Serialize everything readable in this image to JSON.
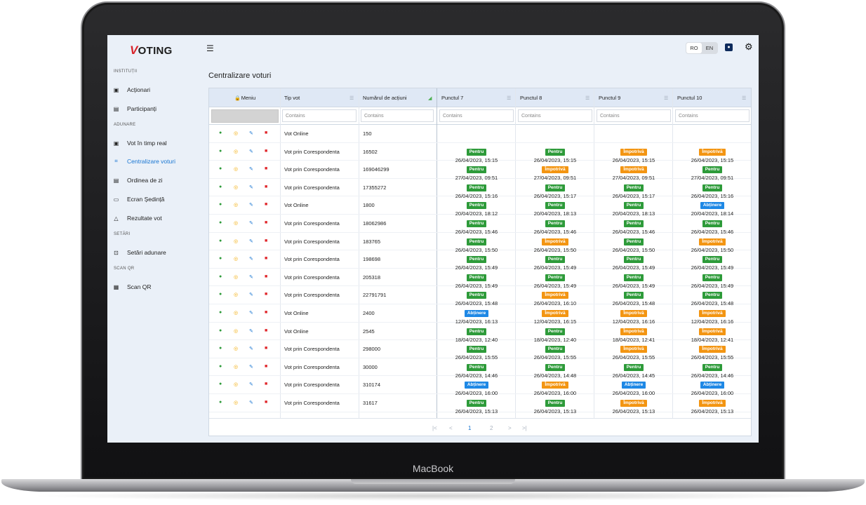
{
  "device": {
    "label": "MacBook"
  },
  "app": {
    "logo_v": "V",
    "logo_rest": "OTING",
    "page_title": "Centralizare voturi",
    "lang": {
      "ro": "RO",
      "en": "EN"
    },
    "icons": {
      "menu": "hamburger-icon",
      "user": "user-icon",
      "settings": "gear-icon"
    }
  },
  "sidebar": {
    "sections": [
      "INSTITUȚII",
      "ADUNARE",
      "SETĂRI",
      "SCAN QR"
    ],
    "items": [
      {
        "label": "Acționari",
        "icon": "id-card-icon"
      },
      {
        "label": "Participanți",
        "icon": "users-icon"
      },
      {
        "label": "Vot în timp real",
        "icon": "realtime-icon"
      },
      {
        "label": "Centralizare voturi",
        "icon": "centralize-icon",
        "active": true
      },
      {
        "label": "Ordinea de zi",
        "icon": "document-icon"
      },
      {
        "label": "Ecran Ședință",
        "icon": "monitor-icon"
      },
      {
        "label": "Rezultate vot",
        "icon": "results-icon"
      },
      {
        "label": "Setări adunare",
        "icon": "settings-box-icon"
      },
      {
        "label": "Scan QR",
        "icon": "qr-icon"
      }
    ]
  },
  "grid": {
    "columns": {
      "menu": "Meniu",
      "tip_vot": "Tip vot",
      "nr_actiuni": "Numărul de acțiuni",
      "p7": "Punctul 7",
      "p8": "Punctul 8",
      "p9": "Punctul 9",
      "p10": "Punctul 10"
    },
    "filter_placeholder": "Contains",
    "vote_labels": {
      "P": "Pentru",
      "I": "Împotrivă",
      "A": "Abținere"
    },
    "rows": [
      {
        "tip": "Vot Online",
        "nr": "150",
        "votes": []
      },
      {
        "tip": "Vot prin Corespondenta",
        "nr": "16502",
        "votes": [
          [
            "P",
            "26/04/2023, 15:15"
          ],
          [
            "P",
            "26/04/2023, 15:15"
          ],
          [
            "I",
            "26/04/2023, 15:15"
          ],
          [
            "I",
            "26/04/2023, 15:15"
          ]
        ]
      },
      {
        "tip": "Vot prin Corespondenta",
        "nr": "169046299",
        "votes": [
          [
            "P",
            "27/04/2023, 09:51"
          ],
          [
            "I",
            "27/04/2023, 09:51"
          ],
          [
            "I",
            "27/04/2023, 09:51"
          ],
          [
            "P",
            "27/04/2023, 09:51"
          ]
        ]
      },
      {
        "tip": "Vot prin Corespondenta",
        "nr": "17355272",
        "votes": [
          [
            "P",
            "26/04/2023, 15:16"
          ],
          [
            "P",
            "26/04/2023, 15:17"
          ],
          [
            "P",
            "26/04/2023, 15:17"
          ],
          [
            "P",
            "26/04/2023, 15:16"
          ]
        ]
      },
      {
        "tip": "Vot Online",
        "nr": "1800",
        "votes": [
          [
            "P",
            "20/04/2023, 18:12"
          ],
          [
            "P",
            "20/04/2023, 18:13"
          ],
          [
            "P",
            "20/04/2023, 18:13"
          ],
          [
            "A",
            "20/04/2023, 18:14"
          ]
        ]
      },
      {
        "tip": "Vot prin Corespondenta",
        "nr": "18062986",
        "votes": [
          [
            "P",
            "26/04/2023, 15:46"
          ],
          [
            "P",
            "26/04/2023, 15:46"
          ],
          [
            "P",
            "26/04/2023, 15:46"
          ],
          [
            "P",
            "26/04/2023, 15:46"
          ]
        ]
      },
      {
        "tip": "Vot prin Corespondenta",
        "nr": "183765",
        "votes": [
          [
            "P",
            "26/04/2023, 15:50"
          ],
          [
            "I",
            "26/04/2023, 15:50"
          ],
          [
            "P",
            "26/04/2023, 15:50"
          ],
          [
            "I",
            "26/04/2023, 15:50"
          ]
        ]
      },
      {
        "tip": "Vot prin Corespondenta",
        "nr": "198698",
        "votes": [
          [
            "P",
            "26/04/2023, 15:49"
          ],
          [
            "P",
            "26/04/2023, 15:49"
          ],
          [
            "P",
            "26/04/2023, 15:49"
          ],
          [
            "P",
            "26/04/2023, 15:49"
          ]
        ]
      },
      {
        "tip": "Vot prin Corespondenta",
        "nr": "205318",
        "votes": [
          [
            "P",
            "26/04/2023, 15:49"
          ],
          [
            "P",
            "26/04/2023, 15:49"
          ],
          [
            "P",
            "26/04/2023, 15:49"
          ],
          [
            "P",
            "26/04/2023, 15:49"
          ]
        ]
      },
      {
        "tip": "Vot prin Corespondenta",
        "nr": "22791791",
        "votes": [
          [
            "P",
            "26/04/2023, 15:48"
          ],
          [
            "I",
            "26/04/2023, 16:10"
          ],
          [
            "P",
            "26/04/2023, 15:48"
          ],
          [
            "P",
            "26/04/2023, 15:48"
          ]
        ]
      },
      {
        "tip": "Vot Online",
        "nr": "2400",
        "votes": [
          [
            "A",
            "12/04/2023, 16:13"
          ],
          [
            "I",
            "12/04/2023, 16:15"
          ],
          [
            "I",
            "12/04/2023, 16:16"
          ],
          [
            "I",
            "12/04/2023, 16:16"
          ]
        ]
      },
      {
        "tip": "Vot Online",
        "nr": "2545",
        "votes": [
          [
            "P",
            "18/04/2023, 12:40"
          ],
          [
            "P",
            "18/04/2023, 12:40"
          ],
          [
            "I",
            "18/04/2023, 12:41"
          ],
          [
            "I",
            "18/04/2023, 12:41"
          ]
        ]
      },
      {
        "tip": "Vot prin Corespondenta",
        "nr": "298000",
        "votes": [
          [
            "P",
            "26/04/2023, 15:55"
          ],
          [
            "P",
            "26/04/2023, 15:55"
          ],
          [
            "I",
            "26/04/2023, 15:55"
          ],
          [
            "I",
            "26/04/2023, 15:55"
          ]
        ]
      },
      {
        "tip": "Vot prin Corespondenta",
        "nr": "30000",
        "votes": [
          [
            "P",
            "26/04/2023, 14:46"
          ],
          [
            "P",
            "26/04/2023, 14:48"
          ],
          [
            "P",
            "26/04/2023, 14:45"
          ],
          [
            "P",
            "26/04/2023, 14:46"
          ]
        ]
      },
      {
        "tip": "Vot prin Corespondenta",
        "nr": "310174",
        "votes": [
          [
            "A",
            "26/04/2023, 16:00"
          ],
          [
            "I",
            "26/04/2023, 16:00"
          ],
          [
            "A",
            "26/04/2023, 16:00"
          ],
          [
            "A",
            "26/04/2023, 16:00"
          ]
        ]
      },
      {
        "tip": "Vot prin Corespondenta",
        "nr": "31617",
        "votes": [
          [
            "P",
            "26/04/2023, 15:13"
          ],
          [
            "P",
            "26/04/2023, 15:13"
          ],
          [
            "I",
            "26/04/2023, 15:13"
          ],
          [
            "I",
            "26/04/2023, 15:13"
          ]
        ]
      },
      {
        "tip": "",
        "nr": "",
        "votes": [
          [
            "P",
            ""
          ],
          [
            "P",
            ""
          ],
          [
            "P",
            ""
          ],
          [
            "P",
            ""
          ]
        ]
      }
    ]
  },
  "pagination": {
    "first": "|<",
    "prev": "<",
    "pages": [
      "1",
      "2"
    ],
    "current": "1",
    "next": ">",
    "last": ">|"
  }
}
